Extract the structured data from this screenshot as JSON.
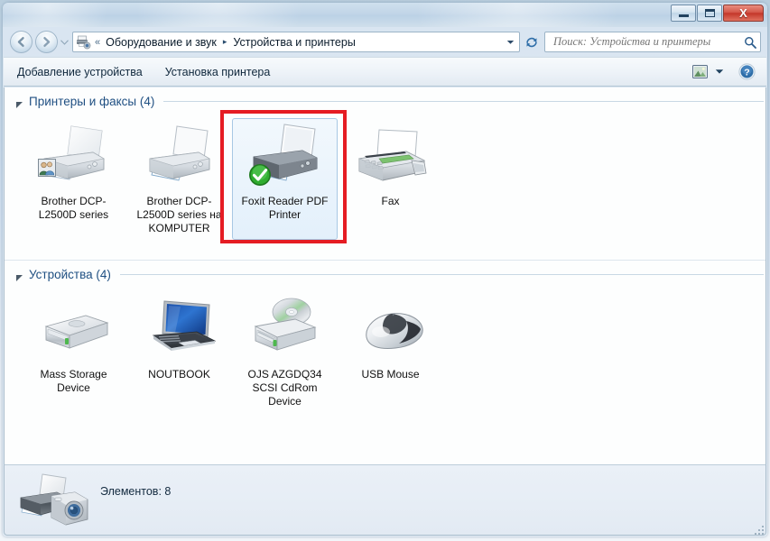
{
  "window": {
    "titlebar": {
      "minimize_label": "",
      "maximize_label": "",
      "close_label": "X"
    }
  },
  "addressbar": {
    "crumb_icon": "devices-and-printers-icon",
    "overflow_chevrons": "«",
    "crumbs": [
      {
        "label": "Оборудование и звук"
      },
      {
        "label": "Устройства и принтеры"
      }
    ],
    "separator": "▸",
    "back_icon": "back-arrow-icon",
    "forward_icon": "forward-arrow-icon",
    "history_icon": "chevron-down-icon",
    "dropdown_icon": "chevron-down-icon",
    "refresh_icon": "refresh-icon"
  },
  "search": {
    "placeholder": "Поиск: Устройства и принтеры",
    "value": "",
    "icon": "search-icon"
  },
  "toolbar": {
    "items": [
      {
        "label": "Добавление устройства"
      },
      {
        "label": "Установка принтера"
      }
    ],
    "view_icon": "change-view-icon",
    "view_dropdown_icon": "chevron-down-icon",
    "help_icon": "help-icon"
  },
  "groups": [
    {
      "title": "Принтеры и факсы (4)",
      "collapse_icon": "triangle-down-icon",
      "items": [
        {
          "label": "Brother DCP-L2500D series",
          "icon": "printer-icon",
          "overlay": "shared-users-icon",
          "selected": false
        },
        {
          "label": "Brother DCP-L2500D series на KOMPUTER",
          "icon": "network-printer-icon",
          "overlay": "",
          "selected": false
        },
        {
          "label": "Foxit Reader PDF Printer",
          "icon": "printer-icon",
          "overlay": "default-printer-check-icon",
          "selected": true
        },
        {
          "label": "Fax",
          "icon": "fax-icon",
          "overlay": "",
          "selected": false
        }
      ]
    },
    {
      "title": "Устройства (4)",
      "collapse_icon": "triangle-down-icon",
      "items": [
        {
          "label": "Mass Storage Device",
          "icon": "external-hard-drive-icon",
          "overlay": "",
          "selected": false
        },
        {
          "label": "NOUTBOOK",
          "icon": "laptop-icon",
          "overlay": "",
          "selected": false
        },
        {
          "label": "OJS AZGDQ34 SCSI CdRom Device",
          "icon": "cdrom-drive-icon",
          "overlay": "",
          "selected": false
        },
        {
          "label": "USB Mouse",
          "icon": "mouse-icon",
          "overlay": "",
          "selected": false
        }
      ]
    }
  ],
  "statusbar": {
    "icon": "printer-and-camera-icon",
    "text": "Элементов: 8"
  },
  "annotation": {
    "highlight_color": "#e51c23",
    "target": "Foxit Reader PDF Printer"
  },
  "colors": {
    "group_title": "#1f4f82",
    "accent": "#1f4f82",
    "close_button": "#c4372a",
    "default_check": "#2f9e2f"
  }
}
